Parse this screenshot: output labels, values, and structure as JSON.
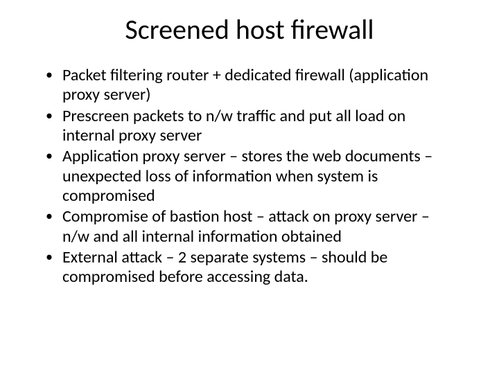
{
  "slide": {
    "title": "Screened host firewall",
    "bullets": [
      "Packet filtering router + dedicated firewall (application proxy server)",
      "Prescreen packets to n/w traffic and put all load on internal proxy server",
      "Application proxy server – stores the web documents – unexpected loss of information when system is compromised",
      "Compromise of bastion host – attack on proxy server – n/w and all internal information obtained",
      "External attack – 2 separate systems – should be compromised before accessing data."
    ]
  }
}
